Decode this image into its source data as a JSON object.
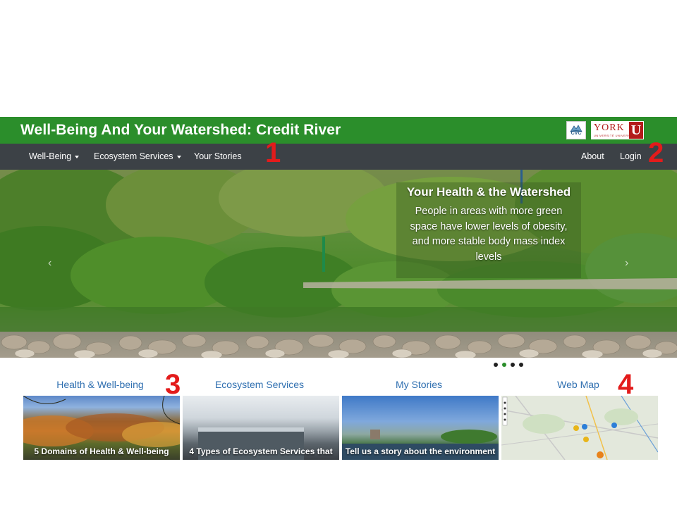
{
  "header": {
    "title": "Well-Being And Your Watershed: Credit River",
    "logos": [
      {
        "name": "cvc-logo",
        "text": "CVC"
      },
      {
        "name": "york-university-logo",
        "text": "YORK",
        "sub": "UNIVERSITÉ UNIVERSITY",
        "mark": "U"
      }
    ],
    "brand_color": "#2b8e2b",
    "nav_color": "#3c4146"
  },
  "nav": {
    "left": [
      {
        "label": "Well-Being",
        "dropdown": true
      },
      {
        "label": "Ecosystem Services",
        "dropdown": true
      },
      {
        "label": "Your Stories",
        "dropdown": false
      }
    ],
    "right": [
      {
        "label": "About"
      },
      {
        "label": "Login"
      }
    ]
  },
  "annotations": [
    "1",
    "2",
    "3",
    "4"
  ],
  "carousel": {
    "caption_title": "Your Health & the Watershed",
    "caption_body": "People in areas with more green space have lower levels of obesity, and more stable body mass index levels",
    "prev_icon": "chevron-left-icon",
    "next_icon": "chevron-right-icon",
    "slide_count": 4,
    "active_index": 1
  },
  "cards": [
    {
      "heading": "Health & Well-being",
      "caption": "5 Domains of Health & Well-being"
    },
    {
      "heading": "Ecosystem Services",
      "caption": "4 Types of Ecosystem Services that"
    },
    {
      "heading": "My Stories",
      "caption": "Tell us a story about the environment"
    },
    {
      "heading": "Web Map",
      "caption": ""
    }
  ],
  "colors": {
    "annotation_red": "#e31b1b",
    "link_blue": "#2f6fb0"
  }
}
